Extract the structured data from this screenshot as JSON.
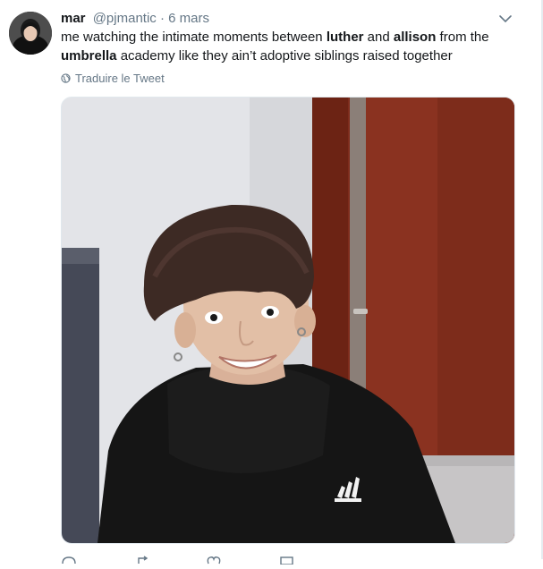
{
  "tweet": {
    "author_name": "mar",
    "author_handle": "@pjmantic",
    "separator": "·",
    "date": "6 mars",
    "text": [
      {
        "t": "me watching the intimate moments between ",
        "b": false
      },
      {
        "t": "luther",
        "b": true
      },
      {
        "t": " and ",
        "b": false
      },
      {
        "t": "allison",
        "b": true
      },
      {
        "t": " from the ",
        "b": false
      },
      {
        "t": "umbrella",
        "b": true
      },
      {
        "t": " academy like they ain’t adoptive siblings raised together",
        "b": false
      }
    ],
    "translate_label": "Traduire le Tweet",
    "icons": {
      "caret": "chevron-down-icon",
      "translate": "globe-icon",
      "reply": "reply-icon",
      "retweet": "retweet-icon",
      "like": "heart-icon",
      "dm": "mail-icon"
    },
    "colors": {
      "text": "#14171a",
      "secondary": "#657786",
      "border": "#e1e8ed"
    }
  }
}
